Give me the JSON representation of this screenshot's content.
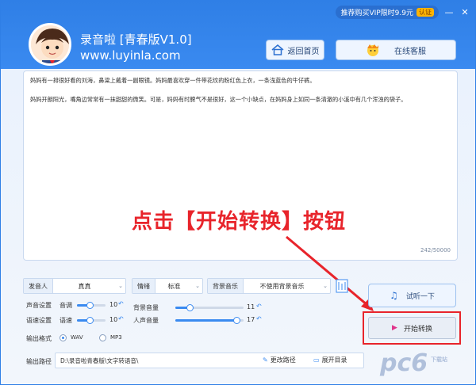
{
  "window": {
    "promo_text": "推荐购买VIP限时9.9元",
    "promo_badge": "认证",
    "minimize": "—",
    "close": "✕"
  },
  "header": {
    "app_name": "录音啦  [青春版V1.0]",
    "url": "www.luyinla.com",
    "home_label": "返回首页",
    "service_label": "在线客服"
  },
  "editor": {
    "paragraph1": "妈妈有一排很好看的刘海，鼻梁上戴着一副眼镜。妈妈最喜欢穿一件带花纹的粉红色上衣，一条浅蓝色的牛仔裤。",
    "paragraph2": "妈妈开朗阳光，嘴角边常常有一抹甜甜的微笑。可是，妈妈有时脾气不是很好，这一个小缺点，在妈妈身上如同一条清澈的小溪中有几个浑浊的袋子。",
    "counter": "242/50000"
  },
  "overlay": {
    "instruction": "点击【开始转换】按钮"
  },
  "controls": {
    "speaker_label": "发音人",
    "speaker_value": "真真",
    "emotion_label": "情绪",
    "emotion_value": "标准",
    "bgm_label": "背景音乐",
    "bgm_value": "不使用背景音乐",
    "voice_setting_label": "声音设置",
    "volume_label": "音调",
    "volume_value": "10",
    "volume_level": 0.45,
    "speed_setting_label": "语速设置",
    "speed_label": "语速",
    "speed_value": "10",
    "speed_level": 0.45,
    "bg_volume_label": "背景音量",
    "bg_volume_value": "11",
    "bg_volume_level": 0.22,
    "voice_volume_label": "人声音量",
    "voice_volume_value": "17",
    "voice_volume_level": 0.9,
    "format_label": "输出格式",
    "format_options": [
      "WAV",
      "MP3"
    ],
    "format_selected": "WAV",
    "path_label": "输出路径",
    "path_value": "D:\\录音啦青春版\\文字转语音\\",
    "change_path": "更改路径",
    "open_dir": "展开目录"
  },
  "actions": {
    "listen_label": "试听一下",
    "start_label": "开始转换"
  },
  "watermark": {
    "text": "pc6",
    "sub": "下载站"
  },
  "colors": {
    "accent": "#3a8af0",
    "highlight_red": "#e8242b"
  }
}
